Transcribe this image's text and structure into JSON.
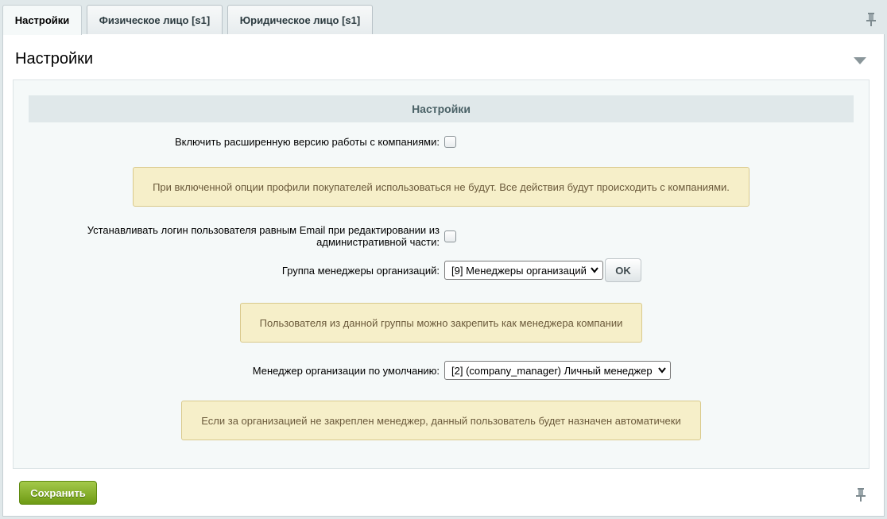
{
  "tabs": [
    {
      "label": "Настройки",
      "active": true
    },
    {
      "label": "Физическое лицо [s1]",
      "active": false
    },
    {
      "label": "Юридическое лицо [s1]",
      "active": false
    }
  ],
  "panel": {
    "title": "Настройки",
    "section_title": "Настройки"
  },
  "settings": {
    "extended_mode": {
      "label": "Включить расширенную версию работы с компаниями:",
      "checked": false,
      "note": "При включенной опции профили покупателей использоваться не будут. Все действия будут происходить с компаниями."
    },
    "login_email": {
      "label_line1": "Устанавливать логин пользователя равным Email при редактировании из",
      "label_line2": "административной части:",
      "checked": false
    },
    "managers_group": {
      "label": "Группа менеджеры организаций:",
      "value": "[9] Менеджеры организаций",
      "ok_label": "OK",
      "note": "Пользователя из данной группы можно закрепить как менеджера компании"
    },
    "default_manager": {
      "label": "Менеджер организации по умолчанию:",
      "value": "[2] (company_manager) Личный менеджер",
      "note": "Если за организацией не закреплен менеджер, данный пользователь будет назначен автоматичеки"
    }
  },
  "footer": {
    "save_label": "Сохранить"
  },
  "icons": {
    "pin": "pin-icon",
    "collapse": "triangle-down-icon",
    "select": "chevron-down-icon"
  },
  "colors": {
    "save_button": "#7aa91c",
    "note_background": "#f6efc9",
    "section_header": "#e0e8ea"
  }
}
